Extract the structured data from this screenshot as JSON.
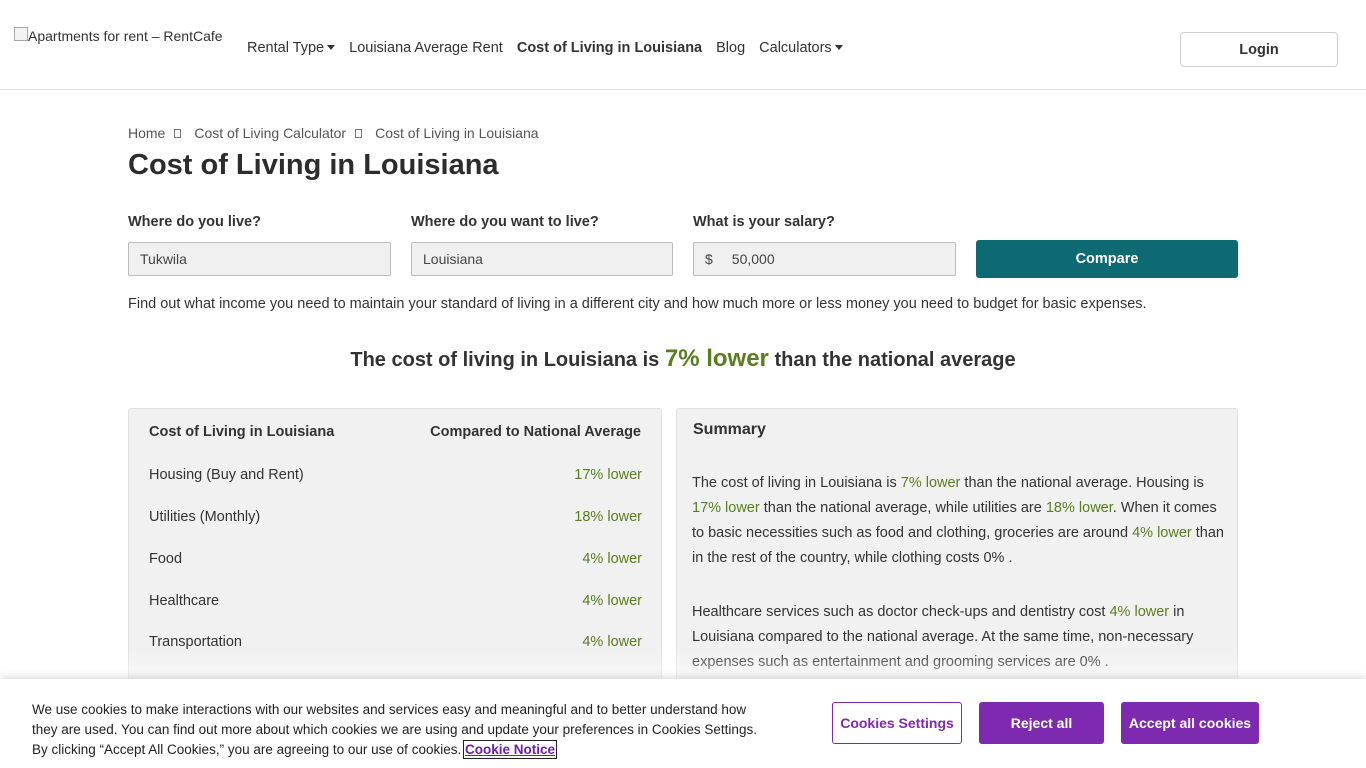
{
  "header": {
    "logo_alt": "Apartments for rent – RentCafe",
    "nav": [
      {
        "label": "Rental Type",
        "dropdown": true
      },
      {
        "label": "Louisiana Average Rent",
        "dropdown": false
      },
      {
        "label": "Cost of Living in Louisiana",
        "dropdown": false,
        "active": true
      },
      {
        "label": "Blog",
        "dropdown": false
      },
      {
        "label": "Calculators",
        "dropdown": true
      }
    ],
    "login_label": "Login"
  },
  "breadcrumb": [
    "Home",
    "Cost of Living Calculator",
    "Cost of Living in Louisiana"
  ],
  "page_title": "Cost of Living in Louisiana",
  "form": {
    "live_label": "Where do you live?",
    "live_value": "Tukwila",
    "want_label": "Where do you want to live?",
    "want_value": "Louisiana",
    "salary_label": "What is your salary?",
    "salary_currency": "$",
    "salary_value": "50,000",
    "compare_label": "Compare"
  },
  "intro": "Find out what income you need to maintain your standard of living in a different city and how much more or less money you need to budget for basic expenses.",
  "headline": {
    "before": "The cost of living in Louisiana is",
    "highlight": "7% lower",
    "after": "than the national average"
  },
  "table": {
    "col1": "Cost of Living in Louisiana",
    "col2": "Compared to National Average",
    "rows": [
      {
        "label": "Housing (Buy and Rent)",
        "value": "17% lower"
      },
      {
        "label": "Utilities (Monthly)",
        "value": "18% lower"
      },
      {
        "label": "Food",
        "value": "4% lower"
      },
      {
        "label": "Healthcare",
        "value": "4% lower"
      },
      {
        "label": "Transportation",
        "value": "4% lower"
      }
    ]
  },
  "summary": {
    "title": "Summary",
    "p1": {
      "t1": "The cost of living in Louisiana is ",
      "g1": "7% lower",
      "t2": " than the national average. Housing is ",
      "g2": "17% lower",
      "t3": " than the national average, while utilities are ",
      "g3": "18% lower",
      "t4": ". When it comes to basic necessities such as food and clothing, groceries are around ",
      "g4": "4% lower",
      "t5": " than in the rest of the country, while clothing costs 0% ."
    },
    "p2": {
      "t1": "Healthcare services such as doctor check-ups and dentistry cost ",
      "g1": "4% lower",
      "t2": " in Louisiana compared to the national average. At the same time, non-necessary expenses such as entertainment and grooming services are 0% ."
    }
  },
  "cookie": {
    "text": "We use cookies to make interactions with our websites and services easy and meaningful and to better understand how they are used. You can find out more about which cookies we are using and update your preferences in Cookies Settings. By clicking “Accept All Cookies,” you are agreeing to our use of cookies. ",
    "link": "Cookie Notice",
    "settings_label": "Cookies Settings",
    "reject_label": "Reject all",
    "accept_label": "Accept all cookies"
  },
  "colors": {
    "accent_green": "#5a7d1f",
    "compare_teal": "#0d6a73",
    "cookie_purple": "#7d2ab1"
  }
}
